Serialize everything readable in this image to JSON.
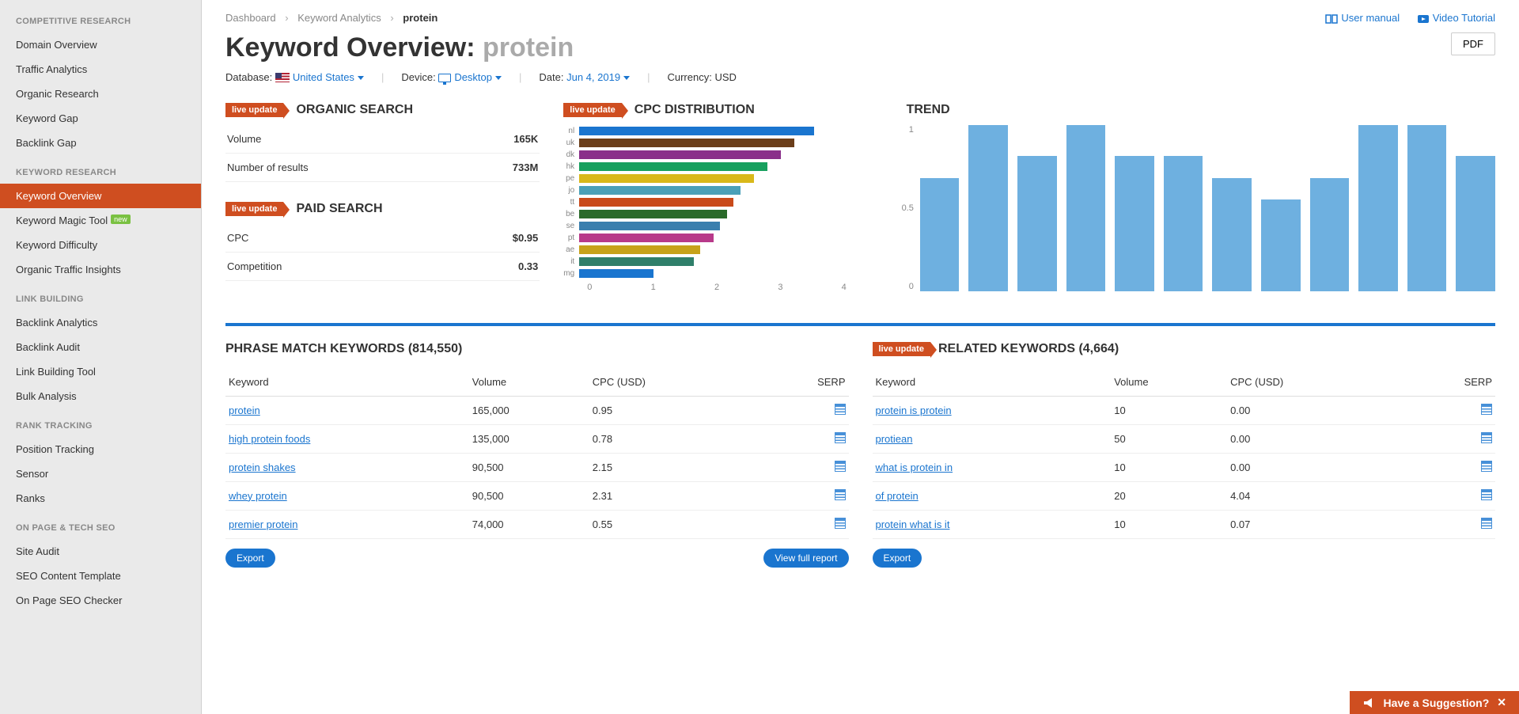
{
  "sidebar": {
    "sections": [
      {
        "title": "COMPETITIVE RESEARCH",
        "items": [
          "Domain Overview",
          "Traffic Analytics",
          "Organic Research",
          "Keyword Gap",
          "Backlink Gap"
        ]
      },
      {
        "title": "KEYWORD RESEARCH",
        "items": [
          "Keyword Overview",
          "Keyword Magic Tool",
          "Keyword Difficulty",
          "Organic Traffic Insights"
        ],
        "active": "Keyword Overview",
        "badges": {
          "Keyword Magic Tool": "new"
        }
      },
      {
        "title": "LINK BUILDING",
        "items": [
          "Backlink Analytics",
          "Backlink Audit",
          "Link Building Tool",
          "Bulk Analysis"
        ]
      },
      {
        "title": "RANK TRACKING",
        "items": [
          "Position Tracking",
          "Sensor",
          "Ranks"
        ]
      },
      {
        "title": "ON PAGE & TECH SEO",
        "items": [
          "Site Audit",
          "SEO Content Template",
          "On Page SEO Checker"
        ]
      }
    ]
  },
  "breadcrumb": [
    "Dashboard",
    "Keyword Analytics",
    "protein"
  ],
  "toplinks": {
    "manual": "User manual",
    "video": "Video Tutorial"
  },
  "heading": {
    "prefix": "Keyword Overview: ",
    "keyword": "protein"
  },
  "pdf_label": "PDF",
  "filters": {
    "database_label": "Database:",
    "database_value": "United States",
    "device_label": "Device:",
    "device_value": "Desktop",
    "date_label": "Date:",
    "date_value": "Jun 4, 2019",
    "currency_label": "Currency:",
    "currency_value": "USD"
  },
  "live_update": "live update",
  "organic": {
    "title": "ORGANIC SEARCH",
    "rows": [
      {
        "label": "Volume",
        "value": "165K"
      },
      {
        "label": "Number of results",
        "value": "733M"
      }
    ]
  },
  "paid": {
    "title": "PAID SEARCH",
    "rows": [
      {
        "label": "CPC",
        "value": "$0.95"
      },
      {
        "label": "Competition",
        "value": "0.33"
      }
    ]
  },
  "cpc_title": "CPC DISTRIBUTION",
  "trend_title": "TREND",
  "tables": {
    "phrase_title": "PHRASE MATCH KEYWORDS (814,550)",
    "related_title": "RELATED KEYWORDS (4,664)",
    "cols": [
      "Keyword",
      "Volume",
      "CPC (USD)",
      "SERP"
    ],
    "phrase_rows": [
      [
        "protein",
        "165,000",
        "0.95"
      ],
      [
        "high protein foods",
        "135,000",
        "0.78"
      ],
      [
        "protein shakes",
        "90,500",
        "2.15"
      ],
      [
        "whey protein",
        "90,500",
        "2.31"
      ],
      [
        "premier protein",
        "74,000",
        "0.55"
      ]
    ],
    "related_rows": [
      [
        "protein is protein",
        "10",
        "0.00"
      ],
      [
        "protiean",
        "50",
        "0.00"
      ],
      [
        "what is protein in",
        "10",
        "0.00"
      ],
      [
        "of protein",
        "20",
        "4.04"
      ],
      [
        "protein what is it",
        "10",
        "0.07"
      ]
    ]
  },
  "btn": {
    "export": "Export",
    "view_full": "View full report"
  },
  "suggest": "Have a Suggestion?",
  "chart_data": {
    "cpc": {
      "type": "bar",
      "categories": [
        "nl",
        "uk",
        "dk",
        "hk",
        "pe",
        "jo",
        "tt",
        "be",
        "se",
        "pt",
        "ae",
        "it",
        "mg"
      ],
      "values": [
        3.5,
        3.2,
        3.0,
        2.8,
        2.6,
        2.4,
        2.3,
        2.2,
        2.1,
        2.0,
        1.8,
        1.7,
        1.1
      ],
      "colors": [
        "#1a75cf",
        "#6b3e1a",
        "#8a2f8a",
        "#17a05e",
        "#d9b81a",
        "#4aa0b8",
        "#c94a1a",
        "#2a6a2a",
        "#3a7fae",
        "#b83a8a",
        "#c7a21a",
        "#2f7f6a",
        "#1a75cf"
      ],
      "xlim": [
        0,
        4
      ],
      "xticks": [
        0,
        1,
        2,
        3,
        4
      ]
    },
    "trend": {
      "type": "bar",
      "values": [
        0.68,
        1.0,
        0.81,
        1.0,
        0.81,
        0.81,
        0.68,
        0.55,
        0.68,
        1.0,
        1.0,
        0.81
      ],
      "ylim": [
        0,
        1
      ],
      "yticks": [
        0,
        0.5,
        1
      ]
    }
  }
}
